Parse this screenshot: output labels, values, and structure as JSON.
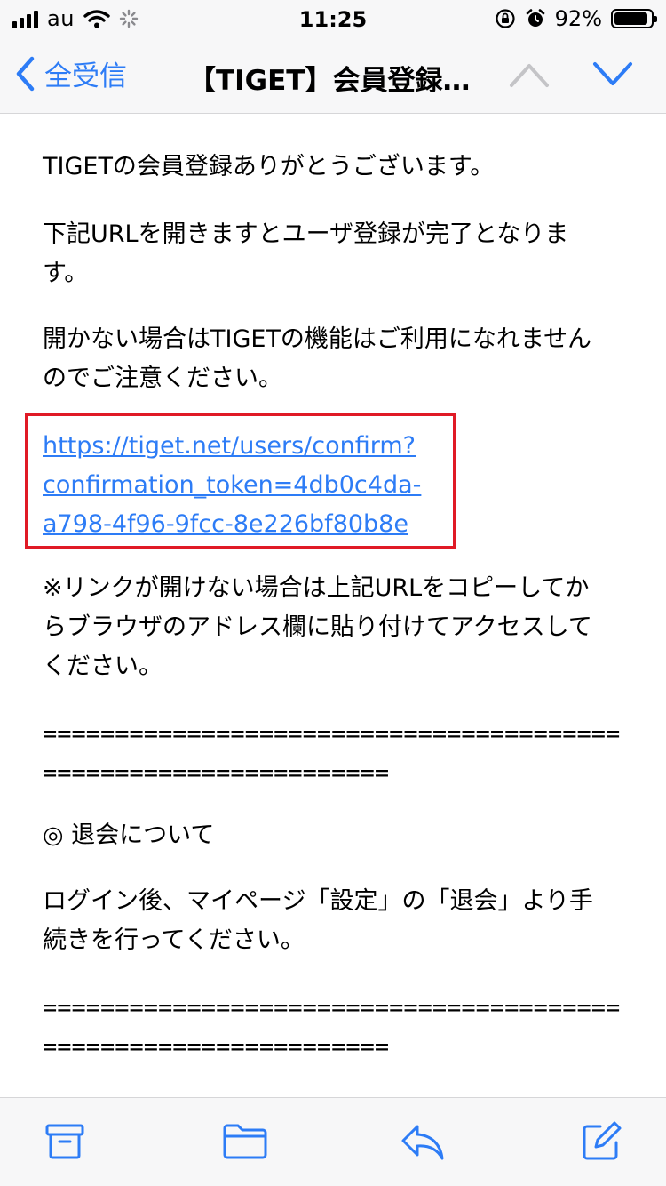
{
  "status_bar": {
    "carrier": "au",
    "time": "11:25",
    "battery_percent_text": "92%",
    "battery_level": 0.92
  },
  "nav": {
    "back_label": "全受信",
    "title": "【TIGET】会員登録あ…"
  },
  "body": {
    "p1": "TIGETの会員登録ありがとうございます。",
    "p2_line1": "下記URLを開きますとユーザ登録が完了となりま",
    "p2_line2": "す。",
    "p3_line1": "開かない場合はTIGETの機能はご利用になれません",
    "p3_line2": "のでご注意ください。",
    "link_line1": "https://tiget.net/users/confirm?",
    "link_line2": "confirmation_token=4db0c4da-",
    "link_line3": "a798-4f96-9fcc-8e226bf80b8e",
    "note_line1": "※リンクが開けない場合は上記URLをコピーしてか",
    "note_line2": "らブラウザのアドレス欄に貼り付けてアクセスして",
    "note_line3": "ください。",
    "sep1_line1": "========================================",
    "sep1_line2": "========================",
    "withdraw_heading": "◎ 退会について",
    "withdraw_line1": "ログイン後、マイページ「設定」の「退会」より手",
    "withdraw_line2": "続きを行ってください。",
    "sep2_line1": "========================================",
    "sep2_line2": "========================"
  },
  "colors": {
    "accent": "#2d7cf6",
    "highlight_border": "#e01a26",
    "disabled": "#c4c4c7"
  }
}
